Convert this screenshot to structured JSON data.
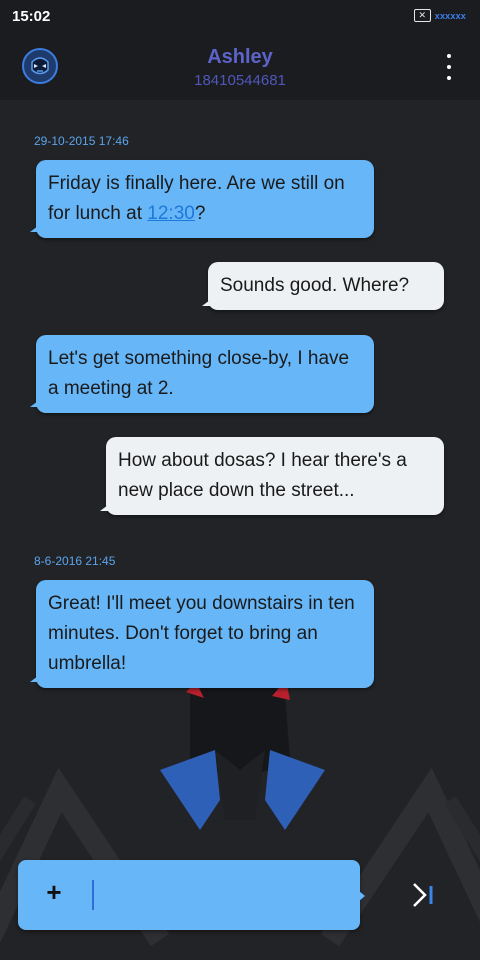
{
  "status_bar": {
    "time": "15:02",
    "sim_icon": "sim-x-icon",
    "carrier": "xxxxxx"
  },
  "header": {
    "avatar_icon": "avatar-icon",
    "contact_name": "Ashley",
    "contact_number": "18410544681",
    "menu_icon": "more-vert-icon"
  },
  "conversation": {
    "timestamps": [
      "29-10-2015 17:46",
      "8-6-2016 21:45"
    ],
    "messages": [
      {
        "direction": "incoming",
        "text": "Friday is finally here. Are we still on for lunch at ",
        "link": "12:30",
        "after": "?"
      },
      {
        "direction": "outgoing",
        "text": "Sounds good. Where?"
      },
      {
        "direction": "incoming",
        "text": "Let's get something close-by, I have a meeting at 2."
      },
      {
        "direction": "outgoing",
        "text": "How about dosas? I hear there's a new place down the street..."
      },
      {
        "direction": "incoming",
        "text": "Great! I'll meet you downstairs in ten minutes. Don't forget to bring an umbrella!"
      }
    ]
  },
  "composer": {
    "plus_label": "+",
    "input_value": "",
    "input_placeholder": "",
    "send_icon": "send-icon"
  },
  "colors": {
    "incoming_bubble": "#67b6f8",
    "outgoing_bubble": "#eef1f3",
    "background": "#222326",
    "header_name": "#5c63c9",
    "timestamp": "#5aa4ec"
  }
}
